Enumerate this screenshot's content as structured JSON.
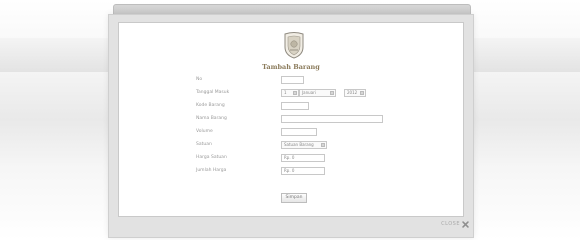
{
  "window": {
    "title": ""
  },
  "form": {
    "title": "Tambah Barang",
    "fields": [
      {
        "label": "No",
        "value": ""
      },
      {
        "label": "Tanggal Masuk",
        "day": "1",
        "month": "Januari",
        "year": "2012"
      },
      {
        "label": "Kode Barang",
        "value": ""
      },
      {
        "label": "Nama Barang",
        "value": ""
      },
      {
        "label": "Volume",
        "value": ""
      },
      {
        "label": "Satuan",
        "value": "Satuan Barang"
      },
      {
        "label": "Harga Satuan",
        "value": "Rp. 0"
      },
      {
        "label": "Jumlah Harga",
        "value": "Rp. 0"
      }
    ],
    "submit_label": "Simpan"
  },
  "close": {
    "label": "CLOSE",
    "icon": "close-icon"
  },
  "logo": {
    "icon": "emblem-icon"
  }
}
